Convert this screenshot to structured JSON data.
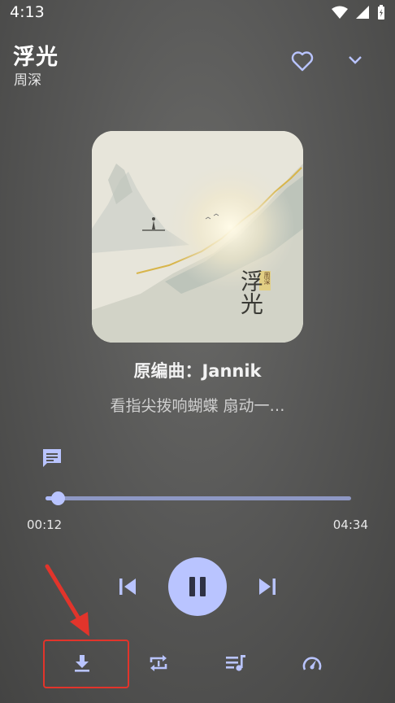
{
  "status": {
    "time": "4:13"
  },
  "song": {
    "title": "浮光",
    "artist": "周深"
  },
  "album": {
    "cover_text_artist": "周深",
    "cover_text_title": "浮光"
  },
  "lyrics": {
    "line1": "原编曲：Jannik",
    "line2": "看指尖拨响蝴蝶  扇动一…"
  },
  "progress": {
    "current": "00:12",
    "total": "04:34",
    "fraction": 0.04
  },
  "colors": {
    "accent": "#b9c4ff",
    "highlight_box": "#e2342b"
  },
  "icons": [
    "wifi-icon",
    "signal-icon",
    "battery-icon",
    "heart-icon",
    "chevron-down-icon",
    "comment-icon",
    "skip-previous-icon",
    "pause-icon",
    "skip-next-icon",
    "download-icon",
    "repeat-icon",
    "playlist-icon",
    "speed-icon"
  ]
}
